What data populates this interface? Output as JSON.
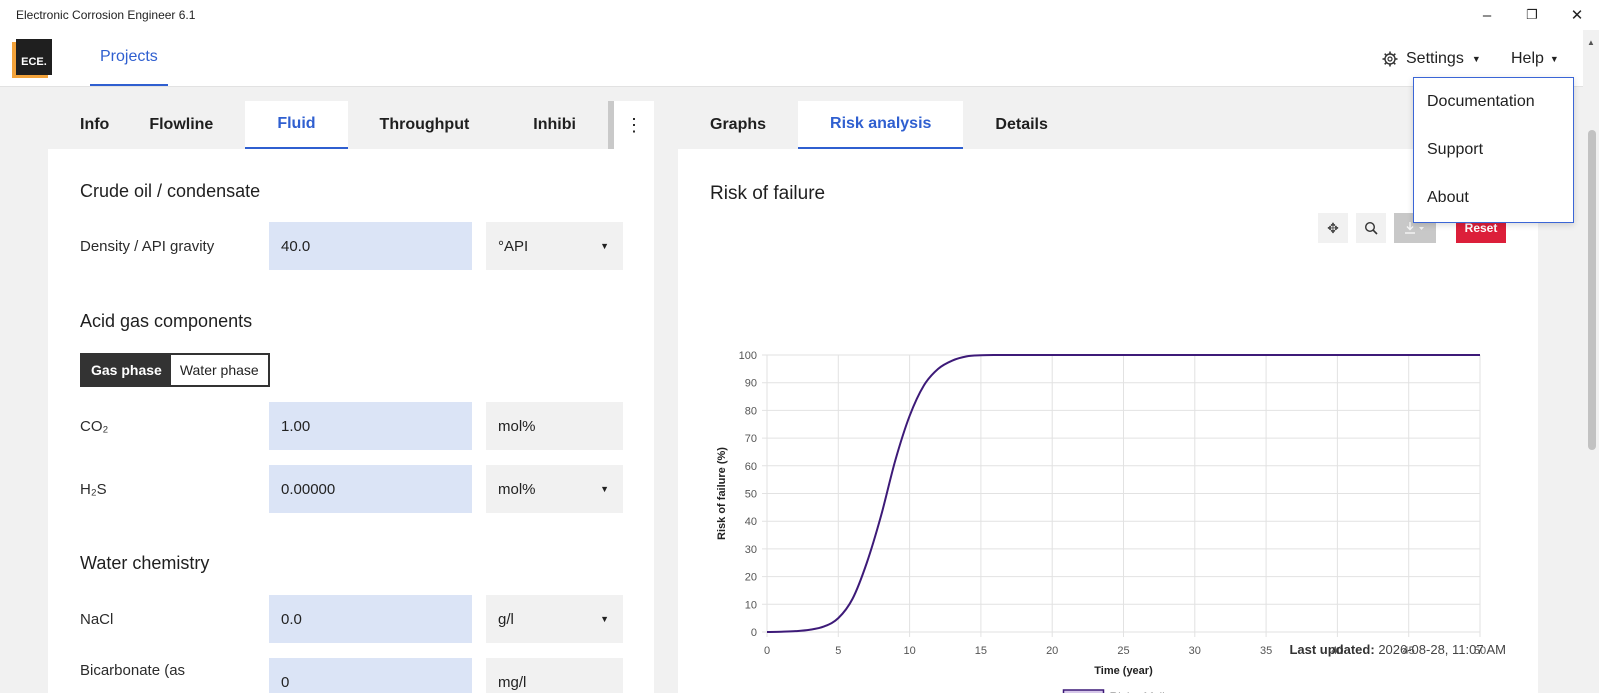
{
  "window": {
    "title": "Electronic Corrosion Engineer 6.1",
    "minimize": "–",
    "restore": "❐",
    "close": "✕"
  },
  "header": {
    "logo_text": "ECE.",
    "nav_projects": "Projects",
    "settings_label": "Settings",
    "help_label": "Help"
  },
  "help_menu": {
    "items": [
      "Documentation",
      "Support",
      "About"
    ]
  },
  "left_tabs": [
    {
      "label": "Info"
    },
    {
      "label": "Flowline"
    },
    {
      "label": "Fluid"
    },
    {
      "label": "Throughput"
    },
    {
      "label": "Inhibi"
    }
  ],
  "fluid": {
    "section_crude": "Crude oil / condensate",
    "density_label": "Density / API gravity",
    "density_value": "40.0",
    "density_unit": "°API",
    "section_acid": "Acid gas components",
    "toggle_gas": "Gas phase",
    "toggle_water": "Water phase",
    "co2_label": "CO₂",
    "co2_value": "1.00",
    "co2_unit": "mol%",
    "h2s_label": "H₂S",
    "h2s_value": "0.00000",
    "h2s_unit": "mol%",
    "section_water": "Water chemistry",
    "nacl_label": "NaCl",
    "nacl_value": "0.0",
    "nacl_unit": "g/l",
    "bicarb_label": "Bicarbonate (as",
    "bicarb_value": "0",
    "bicarb_unit": "mg/l"
  },
  "right_tabs": [
    {
      "label": "Graphs"
    },
    {
      "label": "Risk analysis"
    },
    {
      "label": "Details"
    }
  ],
  "risk": {
    "title": "Risk of failure",
    "reset_label": "Reset",
    "last_updated_label": "Last updated:",
    "last_updated_value": "2026-08-28, 11:07 AM"
  },
  "colors": {
    "accent": "#2f5fd0",
    "line": "#3d1a78",
    "legend_fill": "#d7c8ea",
    "reset": "#dc1f3a"
  },
  "chart_data": {
    "type": "line",
    "title": "",
    "xlabel": "Time (year)",
    "ylabel": "Risk of failure (%)",
    "xlim": [
      0,
      50
    ],
    "ylim": [
      0,
      100
    ],
    "xticks": [
      0,
      5,
      10,
      15,
      20,
      25,
      30,
      35,
      40,
      45,
      50
    ],
    "yticks": [
      0,
      10,
      20,
      30,
      40,
      50,
      60,
      70,
      80,
      90,
      100
    ],
    "grid": true,
    "legend_position": "bottom",
    "series": [
      {
        "name": "Risk of failure",
        "x": [
          0,
          1,
          2,
          3,
          4,
          5,
          6,
          7,
          8,
          9,
          10,
          11,
          12,
          13,
          14,
          15,
          16,
          18,
          20,
          25,
          30,
          35,
          40,
          45,
          50
        ],
        "y": [
          0,
          0.1,
          0.3,
          0.8,
          2,
          5,
          12,
          25,
          42,
          62,
          78,
          89,
          95,
          98,
          99.5,
          99.9,
          100,
          100,
          100,
          100,
          100,
          100,
          100,
          100,
          100
        ]
      }
    ]
  }
}
